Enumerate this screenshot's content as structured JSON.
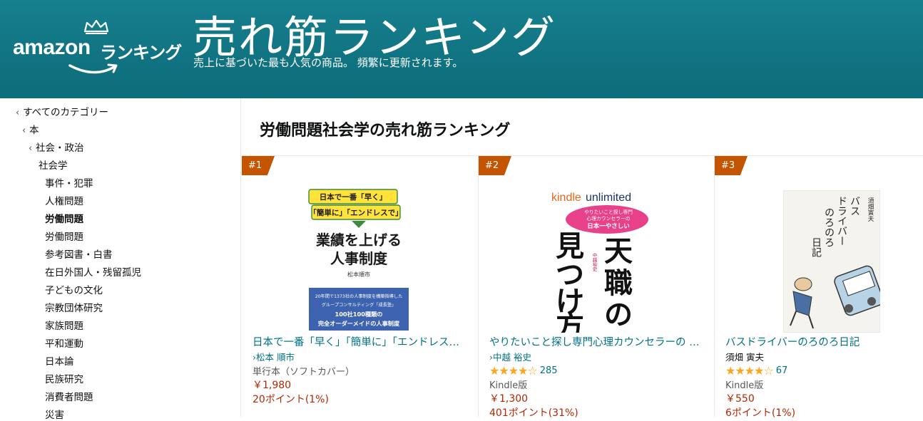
{
  "header": {
    "logo_amazon": "amazon",
    "logo_ranking": "ランキング",
    "title": "売れ筋ランキング",
    "subtitle": "売上に基づいた最も人気の商品。 頻繁に更新されます。"
  },
  "sidebar": {
    "items": [
      {
        "label": "すべてのカテゴリー",
        "chevron": "‹"
      },
      {
        "label": "本",
        "chevron": "‹"
      },
      {
        "label": "社会・政治",
        "chevron": "‹"
      },
      {
        "label": "社会学"
      },
      {
        "label": "事件・犯罪"
      },
      {
        "label": "人権問題"
      },
      {
        "label": "労働問題",
        "current": true
      },
      {
        "label": "労働問題"
      },
      {
        "label": "参考図書・白書"
      },
      {
        "label": "在日外国人・残留孤児"
      },
      {
        "label": "子どもの文化"
      },
      {
        "label": "宗教団体研究"
      },
      {
        "label": "家族問題"
      },
      {
        "label": "平和運動"
      },
      {
        "label": "日本論"
      },
      {
        "label": "民族研究"
      },
      {
        "label": "消費者問題"
      },
      {
        "label": "災害"
      }
    ]
  },
  "main": {
    "title": "労働問題社会学の売れ筋ランキング",
    "products": [
      {
        "rank": "#1",
        "title": "日本で一番「早く」「簡単に」「エンドレスで」業績を上げる人事制度",
        "author": "松本 順市",
        "format": "単行本（ソフトカバー）",
        "price": "￥1,980",
        "points": "20ポイント(1%)",
        "cover": {
          "line1": "日本で一番「早く」",
          "line2": "「簡単に」「エンドレスで」",
          "title1": "業績を上げる",
          "title2": "人事制度",
          "author": "松本順市",
          "box1": "20年間で1373社の人事制度を構築指導した",
          "box2": "グループコンサルティング「成長塾」",
          "box3": "100社100種類の",
          "box4": "完全オーダーメイドの人事制度"
        }
      },
      {
        "rank": "#2",
        "title": "やりたいこと探し専門心理カウンセラーの 日本一やさしい天職の見つけ方",
        "author": "中越 裕史",
        "rating": 4.0,
        "rating_stars": "★★★★☆",
        "reviews": "285",
        "format": "Kindle版",
        "price": "￥1,300",
        "points": "401ポイント(31%)",
        "cover": {
          "kindle1": "kindle",
          "kindle2": "unlimited",
          "bubble1": "やりたいこと探し専門",
          "bubble2": "心理カウンセラーの",
          "bubble3": "日本一やさしい",
          "big_right1": "天",
          "big_right2": "職",
          "big_right3": "の",
          "big_left1": "見",
          "big_left2": "つ",
          "big_left3": "け",
          "big_left4": "方",
          "author": "中越裕史"
        }
      },
      {
        "rank": "#3",
        "title": "バスドライバーのろのろ日記",
        "author": "須畑 寅夫",
        "rating": 4.0,
        "rating_stars": "★★★★☆",
        "reviews": "67",
        "format": "Kindle版",
        "price": "￥550",
        "points": "6ポイント(1%)",
        "cover": {
          "t1": "バス",
          "t2": "ドライバー",
          "t3": "のろのろ",
          "t4": "日記",
          "author": "須畑寅夫"
        }
      }
    ]
  },
  "colors": {
    "header": "#117482",
    "link": "#007185",
    "price": "#b12704",
    "badge": "#c45500",
    "star": "#ffa41c"
  }
}
